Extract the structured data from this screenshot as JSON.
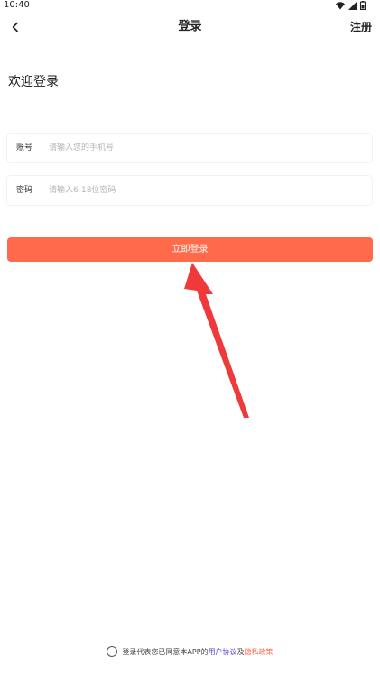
{
  "status_bar": {
    "time": "10:40",
    "icons": [
      "wifi-icon",
      "signal-icon",
      "battery-icon"
    ]
  },
  "nav": {
    "back_icon": "chevron-left-icon",
    "title": "登录",
    "register_label": "注册"
  },
  "welcome_text": "欢迎登录",
  "account_field": {
    "label": "账号",
    "placeholder": "请输入您的手机号",
    "value": ""
  },
  "password_field": {
    "label": "密码",
    "placeholder": "请输入6-18位密码",
    "value": ""
  },
  "login_button": {
    "label": "立即登录"
  },
  "agreement": {
    "prefix": "登录代表您已同意本APP的",
    "user_agreement": "用户协议",
    "joiner": "及",
    "privacy_policy": "隐私政策"
  },
  "colors": {
    "accent": "#ff6a4a",
    "arrow": "#f0393b",
    "user_link": "#5b3fd1"
  }
}
